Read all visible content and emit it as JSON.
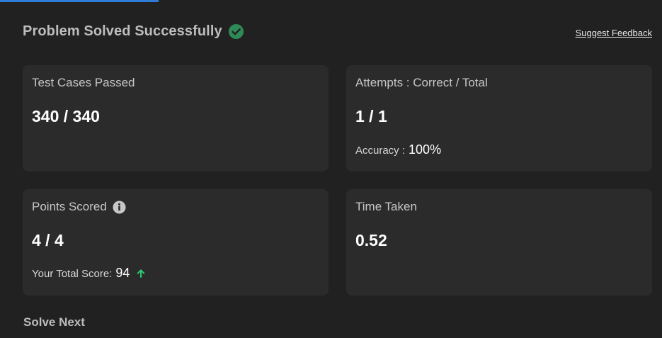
{
  "header": {
    "title": "Problem Solved Successfully",
    "feedback_link": "Suggest Feedback"
  },
  "cards": {
    "test_cases": {
      "label": "Test Cases Passed",
      "value": "340 / 340"
    },
    "attempts": {
      "label": "Attempts : Correct / Total",
      "value": "1 / 1",
      "sub_label": "Accuracy :",
      "sub_value": "100%"
    },
    "points": {
      "label": "Points Scored",
      "value": "4 / 4",
      "sub_label": "Your Total Score:",
      "sub_value": "94"
    },
    "time": {
      "label": "Time Taken",
      "value": "0.52"
    }
  },
  "section": {
    "solve_next": "Solve Next"
  },
  "colors": {
    "background": "#212121",
    "card": "#2b2b2b",
    "success_green": "#2e8b57",
    "tab_indicator_blue": "#2f7bd8",
    "arrow_up_green": "#2ecc71"
  },
  "icons": {
    "title_status": "check-circle-icon",
    "points_info": "info-icon",
    "score_trend": "arrow-up-icon"
  }
}
